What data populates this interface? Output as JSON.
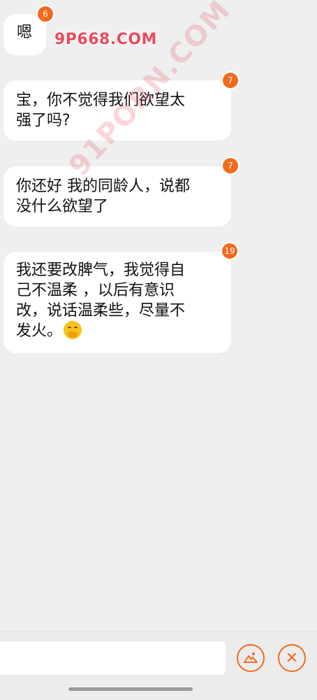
{
  "watermark": {
    "site_top": "9P668.COM",
    "site_diagonal": "91PORN.COM"
  },
  "messages": [
    {
      "text": "嗯",
      "badge": "6"
    },
    {
      "text": "宝，你不觉得我们欲望太\n强了吗?",
      "badge": "7"
    },
    {
      "text": "你还好 我的同龄人，说都\n没什么欲望了",
      "badge": "7"
    },
    {
      "text": "我还要改脾气，我觉得自\n己不温柔 ，以后有意识\n改，说话温柔些，尽量不\n发火。",
      "badge": "19",
      "emoji": "hand-over-mouth-emoji"
    }
  ],
  "bottom_bar": {
    "input_value": "",
    "gift_icon": "gift-icon",
    "close_icon": "close-icon",
    "close_glyph": "✕"
  },
  "colors": {
    "accent": "#f26a1b",
    "background": "#efefef",
    "bubble": "#ffffff",
    "watermark": "#e94a5c"
  }
}
